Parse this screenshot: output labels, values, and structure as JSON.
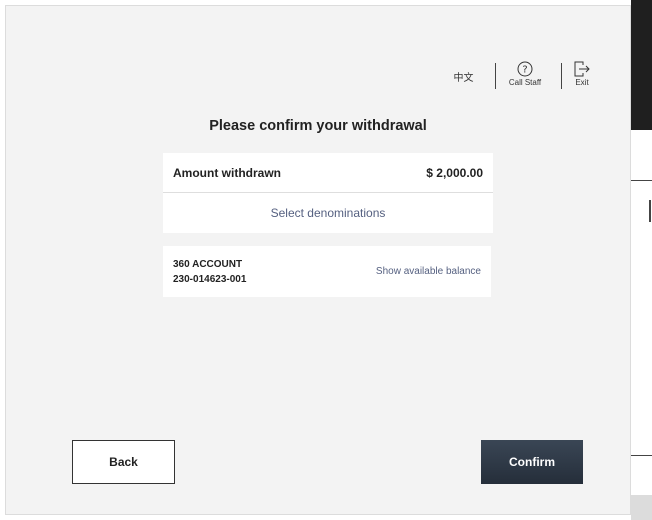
{
  "nav": {
    "language_label": "中文",
    "call_staff_label": "Call Staff",
    "exit_label": "Exit"
  },
  "page": {
    "title": "Please confirm your withdrawal"
  },
  "amount_card": {
    "label": "Amount withdrawn",
    "value": "$ 2,000.00",
    "denominations_link": "Select denominations"
  },
  "account_card": {
    "account_name": "360 ACCOUNT",
    "account_number": "230-014623-001",
    "balance_link": "Show available balance"
  },
  "actions": {
    "back_label": "Back",
    "confirm_label": "Confirm"
  },
  "icons": {
    "call_staff": "question-circle-icon",
    "exit": "exit-door-icon"
  }
}
